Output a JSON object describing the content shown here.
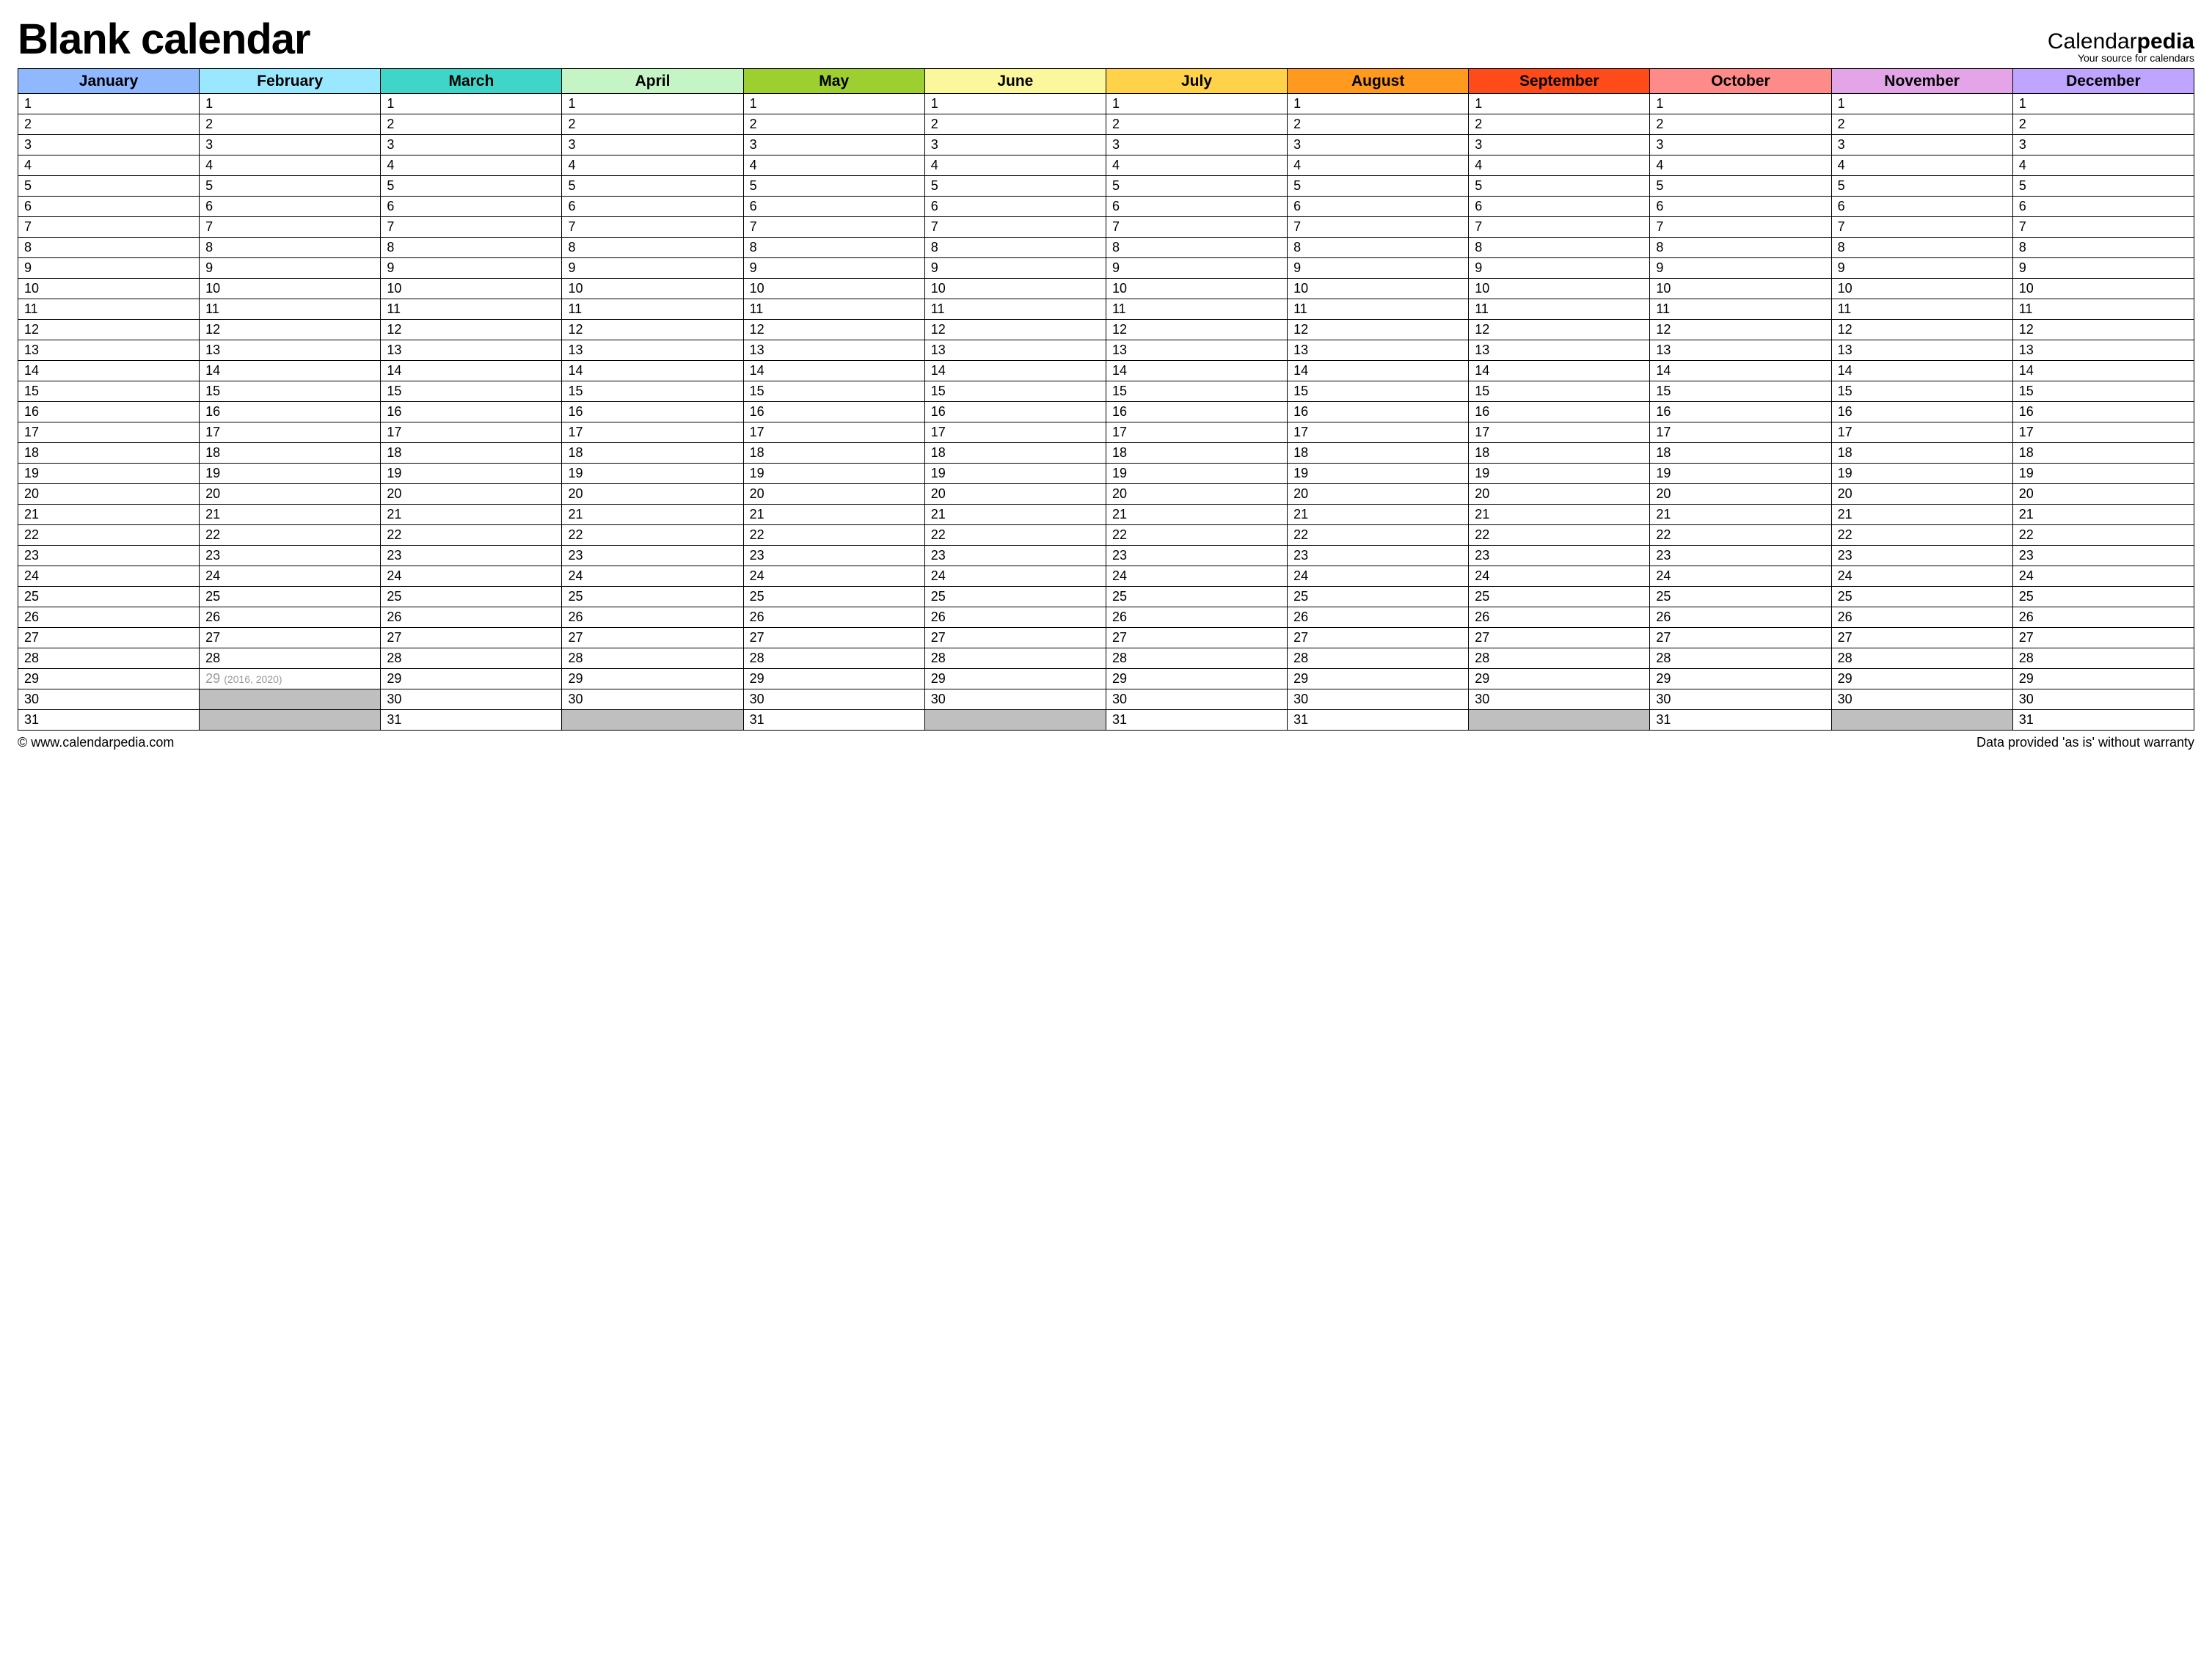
{
  "header": {
    "title": "Blank calendar",
    "brand_part1": "Calendar",
    "brand_part2": "pedia",
    "brand_tagline": "Your source for calendars"
  },
  "months": [
    {
      "name": "January",
      "color": "#8fb8ff",
      "days": 31
    },
    {
      "name": "February",
      "color": "#99e8ff",
      "days": 29,
      "leap": {
        "day": 29,
        "note": "(2016, 2020)"
      },
      "max_normal": 28
    },
    {
      "name": "March",
      "color": "#3fd6c9",
      "days": 31
    },
    {
      "name": "April",
      "color": "#c5f5c5",
      "days": 30
    },
    {
      "name": "May",
      "color": "#9ccf2f",
      "days": 31
    },
    {
      "name": "June",
      "color": "#fbf79c",
      "days": 30
    },
    {
      "name": "July",
      "color": "#ffd24a",
      "days": 31
    },
    {
      "name": "August",
      "color": "#ff9a1f",
      "days": 31
    },
    {
      "name": "September",
      "color": "#ff4a1a",
      "days": 30
    },
    {
      "name": "October",
      "color": "#ff8a8a",
      "days": 31
    },
    {
      "name": "November",
      "color": "#e3a5e8",
      "days": 30
    },
    {
      "name": "December",
      "color": "#bfa5ff",
      "days": 31
    }
  ],
  "max_rows": 31,
  "footer": {
    "copyright": "© www.calendarpedia.com",
    "disclaimer": "Data provided 'as is' without warranty"
  }
}
